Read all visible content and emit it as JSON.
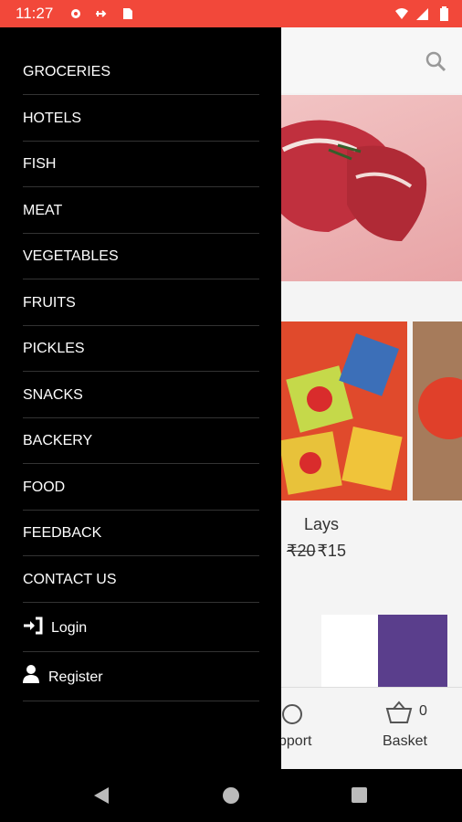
{
  "status_bar": {
    "time": "11:27",
    "background": "#f2483a"
  },
  "drawer": {
    "items": [
      {
        "label": "GROCERIES"
      },
      {
        "label": "HOTELS"
      },
      {
        "label": "FISH"
      },
      {
        "label": "MEAT"
      },
      {
        "label": "VEGETABLES"
      },
      {
        "label": "FRUITS"
      },
      {
        "label": "PICKLES"
      },
      {
        "label": "SNACKS"
      },
      {
        "label": "BACKERY"
      },
      {
        "label": "FOOD"
      },
      {
        "label": "FEEDBACK"
      },
      {
        "label": "CONTACT US"
      }
    ],
    "login_label": "Login",
    "register_label": "Register"
  },
  "products": {
    "featured": {
      "name": "Lays",
      "old_price": "₹20",
      "price": "₹15"
    }
  },
  "bottom_nav": {
    "support_label": "pport",
    "basket_label": "Basket",
    "basket_count": "0"
  },
  "icons": [
    "settings-icon",
    "usb-icon",
    "sd-card-icon",
    "wifi-icon",
    "signal-icon",
    "battery-icon",
    "search-icon",
    "login-icon",
    "user-icon",
    "support-icon",
    "basket-icon",
    "back-icon",
    "home-icon",
    "recents-icon"
  ]
}
